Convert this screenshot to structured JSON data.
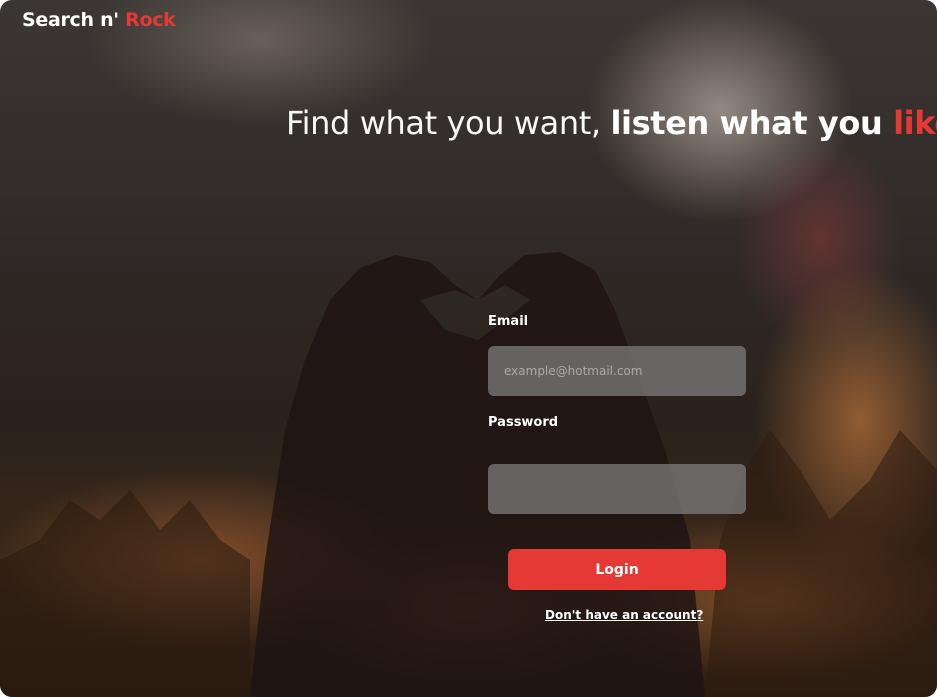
{
  "brand": {
    "name_part1": "Search n' ",
    "name_part2": "Rock"
  },
  "hero": {
    "text_light": "Find what you want, ",
    "text_bold": "listen what you ",
    "text_red": "like"
  },
  "form": {
    "email_label": "Email",
    "email_placeholder": "example@hotmail.com",
    "email_value": "",
    "password_label": "Password",
    "password_value": "",
    "login_label": "Login",
    "signup_link": "Don't have an account?"
  },
  "colors": {
    "accent": "#e53935",
    "field_bg": "#808080",
    "text": "#ffffff"
  }
}
